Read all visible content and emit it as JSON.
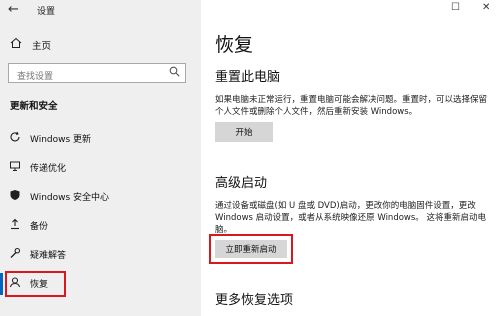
{
  "window": {
    "title": "设置",
    "back_icon": "←",
    "maximize_icon": "☐",
    "close_icon": "✕"
  },
  "sidebar": {
    "home_label": "主页",
    "search_placeholder": "查找设置",
    "section_title": "更新和安全",
    "items": [
      {
        "icon": "windows-update-icon",
        "label": "Windows 更新"
      },
      {
        "icon": "delivery-optimization-icon",
        "label": "传递优化"
      },
      {
        "icon": "windows-security-icon",
        "label": "Windows 安全中心"
      },
      {
        "icon": "backup-icon",
        "label": "备份"
      },
      {
        "icon": "troubleshoot-icon",
        "label": "疑难解答"
      },
      {
        "icon": "recovery-icon",
        "label": "恢复",
        "active": true
      }
    ]
  },
  "main": {
    "title": "恢复",
    "reset": {
      "heading": "重置此电脑",
      "description": "如果电脑未正常运行，重置电脑可能会解决问题。重置时，可以选择保留个人文件或删除个人文件，然后重新安装 Windows。",
      "button": "开始"
    },
    "advanced": {
      "heading": "高级启动",
      "description": "通过设备或磁盘(如 U 盘或 DVD)启动，更改你的电脑固件设置，更改 Windows 启动设置，或者从系统映像还原 Windows。 这将重新启动电脑。",
      "button": "立即重新启动"
    },
    "more": {
      "heading": "更多恢复选项"
    }
  },
  "colors": {
    "accent": "#0067c0",
    "highlight": "#d8181c",
    "sidebar_bg": "#efefef",
    "button_bg": "#d6d6d6"
  }
}
